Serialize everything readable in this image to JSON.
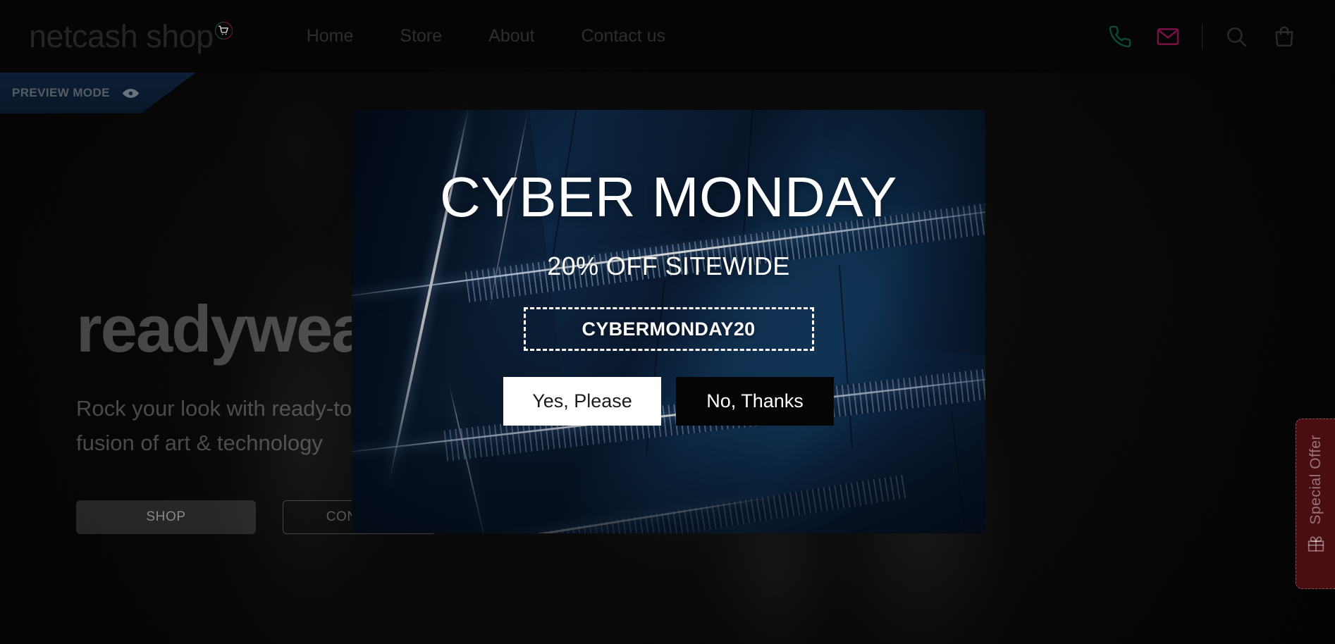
{
  "header": {
    "logo_text": "netcash shop",
    "logo_badge_icon": "cart-badge-icon",
    "nav": [
      {
        "label": "Home"
      },
      {
        "label": "Store"
      },
      {
        "label": "About"
      },
      {
        "label": "Contact us"
      }
    ],
    "icons": [
      {
        "name": "phone-icon",
        "color": "#0e4a3c"
      },
      {
        "name": "envelope-icon",
        "color": "#7a1147"
      },
      {
        "name": "search-icon",
        "color": "#2b2b2b"
      },
      {
        "name": "shopping-bag-icon",
        "color": "#2b2b2b"
      }
    ]
  },
  "preview_banner": {
    "label": "PREVIEW MODE",
    "icon": "eye-icon",
    "color": "#0d1f38"
  },
  "hero": {
    "title": "readywear",
    "subtitle": "Rock your look with ready-to-wear clothing inspired by a fusion of art & technology",
    "primary_button": "SHOP",
    "secondary_button": "CONTACT"
  },
  "modal": {
    "title": "CYBER MONDAY",
    "subtitle": "20% OFF SITEWIDE",
    "coupon_code": "CYBERMONDAY20",
    "accept_button": "Yes, Please",
    "decline_button": "No, Thanks",
    "background_theme": "blue-architecture"
  },
  "side_tab": {
    "label": "Special Offer",
    "icon": "gift-icon",
    "color": "#4a0d12"
  }
}
